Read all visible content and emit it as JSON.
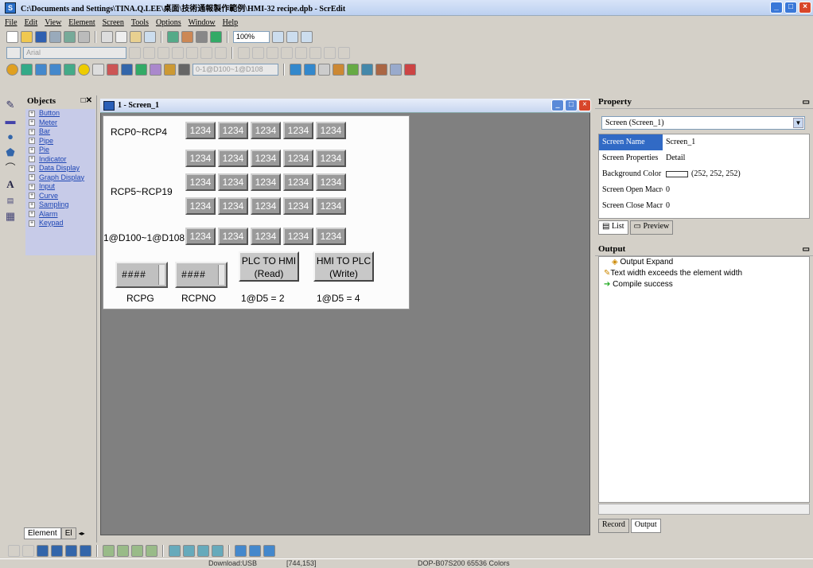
{
  "window": {
    "title": "C:\\Documents and Settings\\TINA.Q.LEE\\桌面\\技術通報製作範例\\HMI-32 recipe.dpb - ScrEdit"
  },
  "menu": [
    "File",
    "Edit",
    "View",
    "Element",
    "Screen",
    "Tools",
    "Options",
    "Window",
    "Help"
  ],
  "toolbar": {
    "zoom": "100%",
    "font": "Arial",
    "address": "0-1@D100~1@D108"
  },
  "objects": {
    "title": "Objects",
    "items": [
      "Button",
      "Meter",
      "Bar",
      "Pipe",
      "Pie",
      "Indicator",
      "Data Display",
      "Graph Display",
      "Input",
      "Curve",
      "Sampling",
      "Alarm",
      "Keypad"
    ],
    "tabs": [
      "Element",
      "El"
    ]
  },
  "screen": {
    "title": "1 - Screen_1",
    "labels": {
      "rcp0_4": "RCP0~RCP4",
      "rcp5_19": "RCP5~RCP19",
      "d100_108": "1@D100~1@D108"
    },
    "value_text": "1234",
    "hash_text": "####",
    "rcpg": "RCPG",
    "rcpno": "RCPNO",
    "btn_read": {
      "line1": "PLC TO HMI",
      "line2": "(Read)"
    },
    "btn_write": {
      "line1": "HMI TO PLC",
      "line2": "(Write)"
    },
    "note_read": "1@D5 = 2",
    "note_write": "1@D5 = 4"
  },
  "property": {
    "title": "Property",
    "selector": "Screen (Screen_1)",
    "rows": [
      {
        "key": "Screen Name",
        "value": "Screen_1"
      },
      {
        "key": "Screen Properties",
        "value": "Detail"
      },
      {
        "key": "Background Color",
        "value": "(252, 252, 252)"
      },
      {
        "key": "Screen Open Macro",
        "value": "0"
      },
      {
        "key": "Screen Close Macro",
        "value": "0"
      }
    ],
    "tabs": [
      "List",
      "Preview"
    ]
  },
  "output": {
    "title": "Output",
    "lines": [
      "Output Expand",
      "Text width exceeds the element width",
      "Compile success"
    ],
    "tabs": [
      "Record",
      "Output"
    ]
  },
  "status": {
    "connection": "Download:USB",
    "coords": "[744,153]",
    "model": "DOP-B07S200 65536 Colors"
  },
  "colors": {
    "accent": "#316ac5",
    "workspace": "#808080",
    "objlist_bg": "#c7cbe8"
  }
}
